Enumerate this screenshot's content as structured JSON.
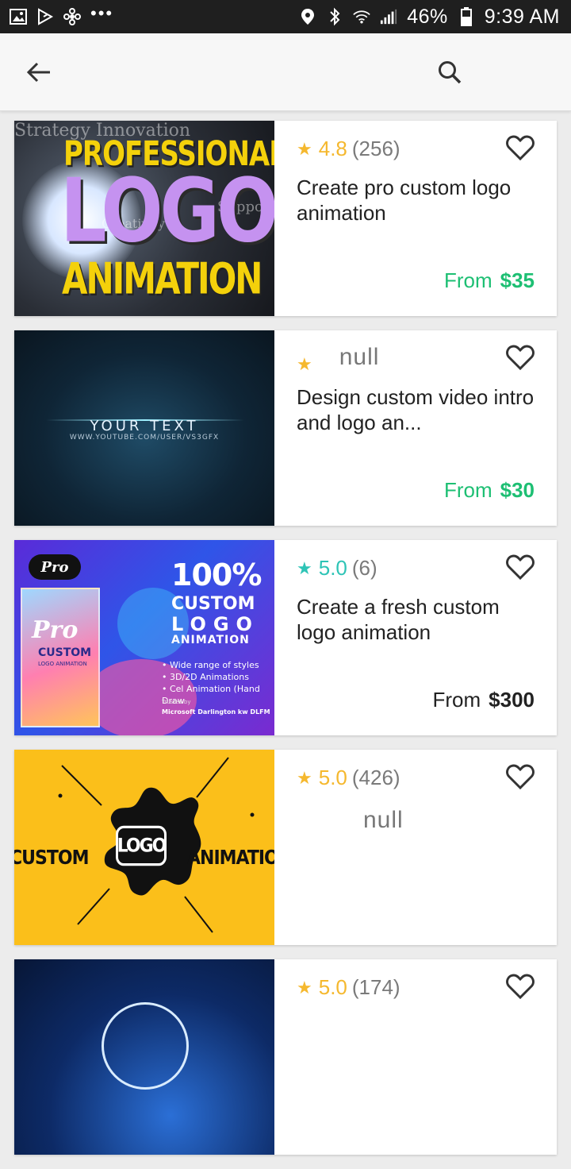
{
  "status_bar": {
    "battery": "46%",
    "time": "9:39 AM",
    "dots": "•••"
  },
  "colors": {
    "accent_green": "#1dbf73",
    "star_yellow": "#f5b82e",
    "star_teal": "#2ec4b6",
    "text_dark": "#222222"
  },
  "gigs": [
    {
      "rating": "4.8",
      "count": "(256)",
      "star_color": "#f5b82e",
      "title": "Create pro custom logo animation",
      "from_label": "From",
      "price": "$35",
      "price_color": "#1dbf73",
      "thumb": {
        "line1": "PROFESSIONAL",
        "line2": "LOGO",
        "line3": "ANIMATION",
        "bg1": "Strategy Innovation",
        "bg2": "Creativity",
        "bg3": "Support"
      }
    },
    {
      "rating": "",
      "null_text": "null",
      "star_color": "#f5b82e",
      "title": "Design custom video intro and  logo an...",
      "from_label": "From",
      "price": "$30",
      "price_color": "#1dbf73",
      "thumb": {
        "line1": "YOUR TEXT",
        "line2": "WWW.YOUTUBE.COM/USER/VS3GFX"
      }
    },
    {
      "rating": "5.0",
      "count": "(6)",
      "star_color": "#2ec4b6",
      "title": "Create a fresh custom logo animation",
      "from_label": "From",
      "price": "$300",
      "price_color": "#222222",
      "thumb": {
        "badge": "Pro",
        "box_pro": "Pro",
        "box_custom": "CUSTOM",
        "box_sub": "LOGO ANIMATION",
        "h1": "100%",
        "h2": "CUSTOM",
        "h3": "LOGO",
        "h4": "ANIMATION",
        "b1": "• Wide range of styles",
        "b2": "• 3D/2D Animations",
        "b3": "• Cel Animation (Hand Draw",
        "trusted": "Trusted by",
        "brands": "Microsoft Darlington kw DLFM"
      }
    },
    {
      "rating": "5.0",
      "count": "(426)",
      "star_color": "#f5b82e",
      "null_text": "null",
      "thumb": {
        "left": "CUSTOM",
        "center": "LOGO",
        "right": "ANIMATION"
      }
    },
    {
      "rating": "5.0",
      "count": "(174)",
      "star_color": "#f5b82e"
    }
  ]
}
